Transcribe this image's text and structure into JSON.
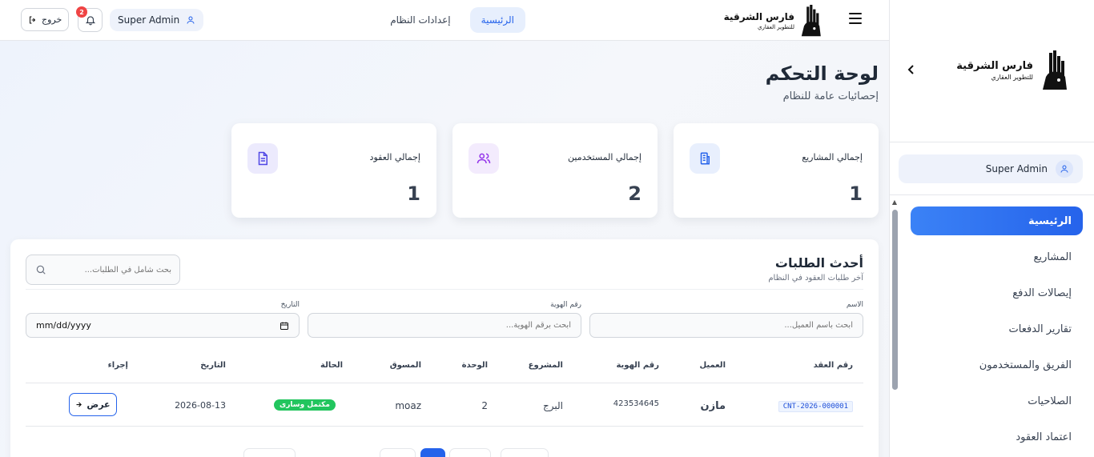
{
  "brand": {
    "name": "فارس الشرقية",
    "tagline": "للتطوير العقاري"
  },
  "topbar": {
    "tabs": [
      {
        "label": "الرئيسية",
        "active": true
      },
      {
        "label": "إعدادات النظام",
        "active": false
      }
    ],
    "user": "Super Admin",
    "notifications": "2",
    "logout": "خروج"
  },
  "sidebar": {
    "user": "Super Admin",
    "items": [
      {
        "label": "الرئيسية",
        "active": true
      },
      {
        "label": "المشاريع"
      },
      {
        "label": "إيصالات الدفع"
      },
      {
        "label": "تقارير الدفعات"
      },
      {
        "label": "الفريق والمستخدمون"
      },
      {
        "label": "الصلاحيات"
      },
      {
        "label": "اعتماد العقود"
      }
    ]
  },
  "page": {
    "title": "لوحة التحكم",
    "subtitle": "إحصائيات عامة للنظام"
  },
  "stats": [
    {
      "label": "إجمالي المشاريع",
      "value": "1",
      "icon": "building-icon",
      "color": "#2563eb",
      "bg": "#e8effd"
    },
    {
      "label": "إجمالي المستخدمين",
      "value": "2",
      "icon": "users-icon",
      "color": "#9333ea",
      "bg": "#f3ebfd"
    },
    {
      "label": "إجمالي العقود",
      "value": "1",
      "icon": "document-icon",
      "color": "#4f46e5",
      "bg": "#eceafd"
    }
  ],
  "requests": {
    "title": "أحدث الطلبات",
    "subtitle": "آخر طلبات العقود في النظام",
    "search_placeholder": "بحث شامل في الطلبات...",
    "filters": {
      "name_label": "الاسم",
      "name_placeholder": "ابحث باسم العميل...",
      "id_label": "رقم الهوية",
      "id_placeholder": "ابحث برقم الهوية...",
      "date_label": "التاريخ",
      "date_placeholder": "mm/dd/yyyy"
    },
    "columns": [
      "رقم العقد",
      "العميل",
      "رقم الهوية",
      "المشروع",
      "الوحدة",
      "المسوق",
      "الحالة",
      "التاريخ",
      "إجراء"
    ],
    "rows": [
      {
        "contract": "CNT-2026-000001",
        "client": "مازن",
        "id_number": "423534645",
        "project": "البرج",
        "unit": "2",
        "marketer": "moaz",
        "status": "مكتمل وسارى",
        "date": "2026-08-13",
        "action": "عرض"
      }
    ]
  }
}
